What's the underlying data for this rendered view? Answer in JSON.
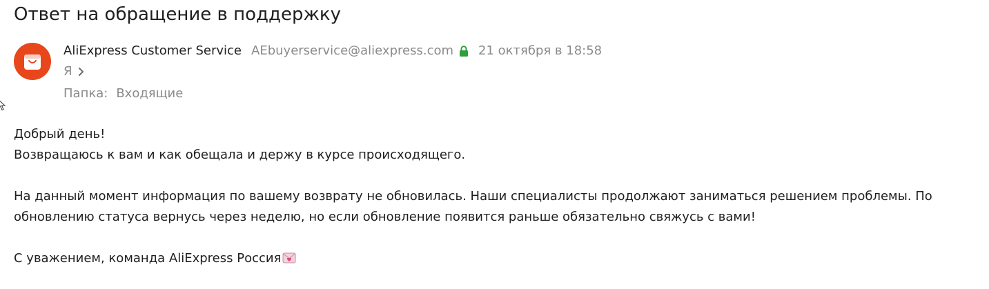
{
  "email": {
    "subject": "Ответ на обращение в поддержку",
    "sender": {
      "name": "AliExpress Customer Service",
      "email": "AEbuyerservice@aliexpress.com",
      "avatar_icon": "aliexpress-bag-icon",
      "avatar_color": "#e8461b"
    },
    "secure_icon": "lock-icon",
    "secure_color": "#2e9e3f",
    "date": "21 октября в 18:58",
    "recipient": "Я",
    "folder_label": "Папка:",
    "folder": "Входящие",
    "body": {
      "greeting": "Добрый день!",
      "line1": "Возвращаюсь к вам и как обещала и держу в курсе происходящего.",
      "paragraph2": "На данный момент информация по вашему возврату не обновилась. Наши специалисты продолжают заниматься решением проблемы. По обновлению статуса вернусь через неделю, но если обновление появится раньше обязательно свяжусь с вами!",
      "signature": "С уважением, команда AliExpress Россия",
      "signature_emoji": "heart-letter-icon"
    }
  }
}
